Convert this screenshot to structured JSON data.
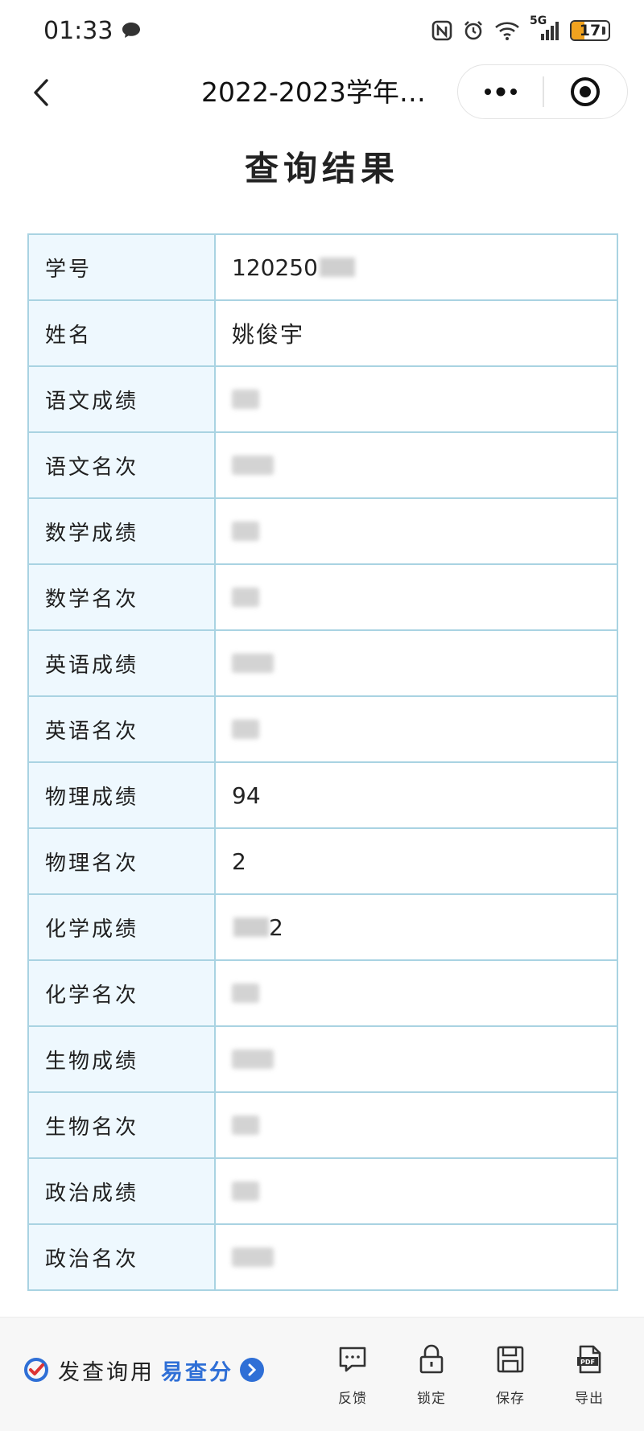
{
  "status_bar": {
    "time": "01:33",
    "network": "5G",
    "battery_level": "17"
  },
  "nav": {
    "title": "2022-2023学年…"
  },
  "page": {
    "heading": "查询结果"
  },
  "results": {
    "rows": [
      {
        "label": "学号",
        "value": "120250",
        "masked": "partial"
      },
      {
        "label": "姓名",
        "value": "姚俊宇",
        "masked": "none"
      },
      {
        "label": "语文成绩",
        "value": "",
        "masked": "full"
      },
      {
        "label": "语文名次",
        "value": "",
        "masked": "full"
      },
      {
        "label": "数学成绩",
        "value": "",
        "masked": "full"
      },
      {
        "label": "数学名次",
        "value": "",
        "masked": "full"
      },
      {
        "label": "英语成绩",
        "value": "",
        "masked": "full"
      },
      {
        "label": "英语名次",
        "value": "",
        "masked": "full"
      },
      {
        "label": "物理成绩",
        "value": "94",
        "masked": "none"
      },
      {
        "label": "物理名次",
        "value": "2",
        "masked": "none"
      },
      {
        "label": "化学成绩",
        "value": "2",
        "masked": "partial"
      },
      {
        "label": "化学名次",
        "value": "",
        "masked": "full"
      },
      {
        "label": "生物成绩",
        "value": "",
        "masked": "full"
      },
      {
        "label": "生物名次",
        "value": "",
        "masked": "full"
      },
      {
        "label": "政治成绩",
        "value": "",
        "masked": "full"
      },
      {
        "label": "政治名次",
        "value": "",
        "masked": "full"
      }
    ]
  },
  "bottom_bar": {
    "promo_text": "发查询用",
    "promo_brand": "易查分",
    "actions": [
      {
        "label": "反馈",
        "icon": "feedback-icon"
      },
      {
        "label": "锁定",
        "icon": "lock-icon"
      },
      {
        "label": "保存",
        "icon": "save-icon"
      },
      {
        "label": "导出",
        "icon": "pdf-export-icon"
      }
    ]
  },
  "colors": {
    "table_border": "#a9d3e2",
    "label_bg": "#eef8fe",
    "brand_blue": "#2f6fd6",
    "battery_fill": "#f0a21f"
  }
}
